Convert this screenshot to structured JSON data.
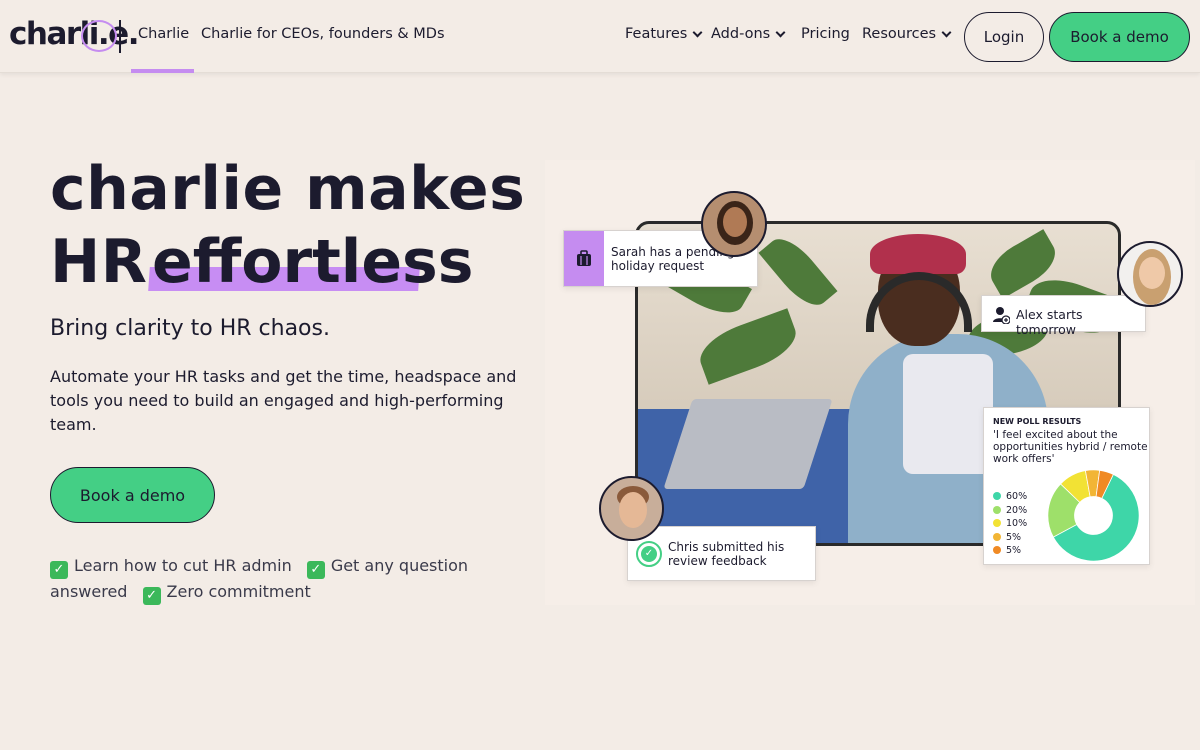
{
  "header": {
    "logo_text": "charli.e.",
    "nav_left": [
      "Charlie",
      "Charlie for CEOs, founders & MDs"
    ],
    "nav_right": [
      {
        "label": "Features",
        "has_dropdown": true
      },
      {
        "label": "Add-ons",
        "has_dropdown": true
      },
      {
        "label": "Pricing",
        "has_dropdown": false
      },
      {
        "label": "Resources",
        "has_dropdown": true
      }
    ],
    "login_label": "Login",
    "demo_label": "Book a demo"
  },
  "hero": {
    "title_line1": "charlie makes",
    "title_line2_a": "HR",
    "title_line2_b": "effortless",
    "subtitle": "Bring clarity to HR chaos.",
    "description": "Automate your HR tasks and get the time, headspace and tools you need to build an engaged and high-performing team.",
    "cta_label": "Book a demo",
    "checks": [
      "Learn how to cut HR admin",
      "Get any question answered",
      "Zero commitment"
    ]
  },
  "illustration": {
    "sarah_card": "Sarah has a pending holiday request",
    "alex_card": "Alex starts tomorrow",
    "chris_card": "Chris submitted his review feedback",
    "poll": {
      "title": "NEW POLL RESULTS",
      "question": "'I feel excited about the opportunities hybrid / remote work offers'",
      "results": [
        {
          "label": "60%",
          "value": 60,
          "color": "#3ed6a8"
        },
        {
          "label": "20%",
          "value": 20,
          "color": "#9ee06a"
        },
        {
          "label": "10%",
          "value": 10,
          "color": "#f2e234"
        },
        {
          "label": "5%",
          "value": 5,
          "color": "#f2b535"
        },
        {
          "label": "5%",
          "value": 5,
          "color": "#f08a24"
        }
      ]
    }
  },
  "colors": {
    "accent_green": "#44cf85",
    "accent_purple": "#c58cf0",
    "background": "#f3ece6",
    "text": "#1c1b2e"
  }
}
